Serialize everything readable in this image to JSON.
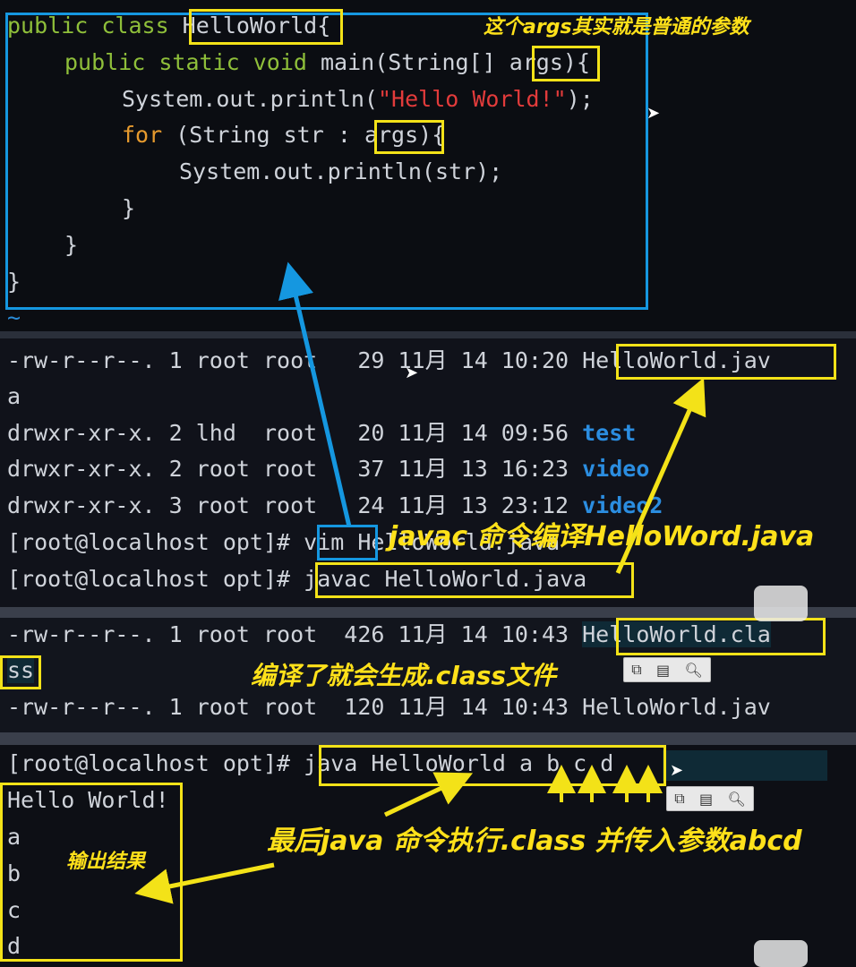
{
  "code": {
    "l1_kw": "public class ",
    "l1_name": "HelloWorld",
    "l1_tail": "{",
    "l2_kw": "public static void ",
    "l2_a": "main(String[] ",
    "l2_args": "args",
    "l2_b": "){",
    "l3_a": "System.out.println(",
    "l3_str": "\"Hello World!\"",
    "l3_b": ");",
    "l4_kw": "for",
    "l4_a": " (String str : ",
    "l4_args": "args",
    "l4_b": "){",
    "l5": "System.out.println(str);",
    "l6": "}",
    "l7": "}",
    "l8": "}",
    "tilde": "~"
  },
  "listing1": {
    "r1_a": "-rw-r--r--. 1 root root   29 11月 14 10:20 ",
    "r1_file": "HelloWorld.jav",
    "r1_wrap": "a",
    "r2_a": "drwxr-xr-x. 2 lhd  root   20 11月 14 09:56 ",
    "r2_dir": "test",
    "r3_a": "drwxr-xr-x. 2 root root   37 11月 13 16:23 ",
    "r3_dir": "video",
    "r4_a": "drwxr-xr-x. 3 root root   24 11月 13 23:12 ",
    "r4_dir": "video2",
    "p1_prompt": "[root@localhost opt]# ",
    "p1_cmd": "vim",
    "p1_arg": " HelloWorld.java",
    "p2_prompt": "[root@localhost opt]# ",
    "p2_cmd": "javac HelloWorld.java"
  },
  "listing2": {
    "r1_a": "-rw-r--r--. 1 root root  426 11月 14 10:43 ",
    "r1_file": "HelloWorld.cla",
    "r1_wrap": "ss",
    "r2": "-rw-r--r--. 1 root root  120 11月 14 10:43 HelloWorld.jav"
  },
  "run": {
    "prompt": "[root@localhost opt]# ",
    "cmd": "java HelloWorld a b c d",
    "out": [
      "Hello World!",
      "a",
      "b",
      "c",
      "d"
    ]
  },
  "annotations": {
    "args_note": "这个args其实就是普通的参数",
    "javac_note": "javac 命令编译HelloWord.java",
    "class_note": "编译了就会生成.class文件",
    "run_note": "最后java 命令执行.class 并传入参数abcd",
    "output_note": "输出结果"
  },
  "colors": {
    "highlight_yellow": "#f3e218",
    "highlight_blue": "#1597e0",
    "annotation_text": "#ffe11a",
    "keyword_green": "#8fbf3a",
    "keyword_orange": "#e69a2e",
    "string_red": "#e23b3b",
    "directory_blue": "#2b8de0"
  },
  "icons": [
    "copy-icon",
    "paste-icon",
    "search-icon"
  ]
}
